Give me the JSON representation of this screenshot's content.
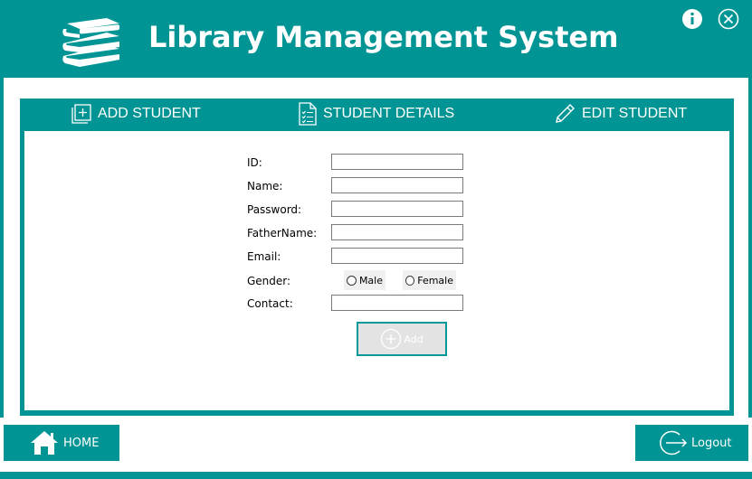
{
  "header": {
    "title": "Library Management System",
    "logo_icon": "books-stack-icon",
    "info_icon": "info-icon",
    "close_icon": "close-circle-icon"
  },
  "tabs": [
    {
      "label": "ADD STUDENT",
      "icon": "add-square-icon"
    },
    {
      "label": "STUDENT DETAILS",
      "icon": "checklist-document-icon"
    },
    {
      "label": "EDIT STUDENT",
      "icon": "pencil-icon"
    }
  ],
  "form": {
    "id_label": "ID:",
    "id_value": "",
    "name_label": "Name:",
    "name_value": "",
    "password_label": "Password:",
    "password_value": "",
    "fathername_label": "FatherName:",
    "fathername_value": "",
    "email_label": "Email:",
    "email_value": "",
    "gender_label": "Gender:",
    "gender_options": [
      "Male",
      "Female"
    ],
    "contact_label": "Contact:",
    "contact_value": "",
    "add_button_label": "Add"
  },
  "footer": {
    "home_label": "HOME",
    "logout_label": "Logout"
  },
  "colors": {
    "accent": "#009494",
    "background": "#ffffff"
  }
}
